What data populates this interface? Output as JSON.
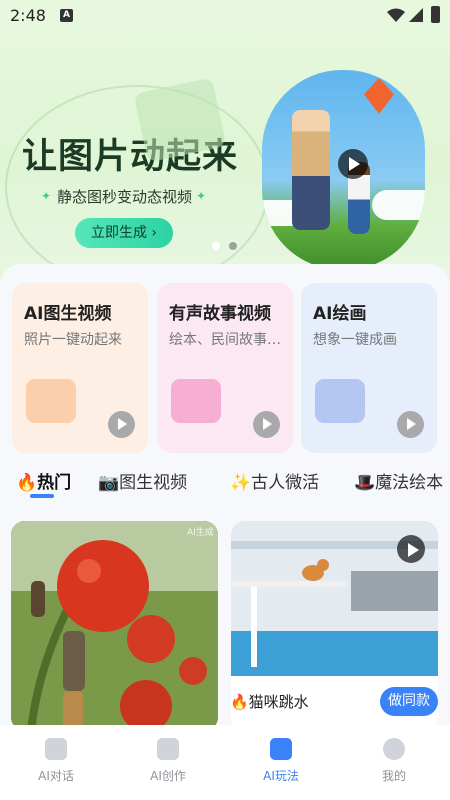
{
  "status_bar": {
    "time": "2:48",
    "notification_badge": "A"
  },
  "hero": {
    "title": "让图片动起来",
    "subtitle": "静态图秒变动态视频",
    "cta_label": "立即生成 ›",
    "carousel_pages": 2,
    "carousel_active_index": 0
  },
  "feature_cards": [
    {
      "title": "AI图生视频",
      "desc": "照片一键动起来",
      "color": "#fdefe4",
      "art_color": "#f9b27e"
    },
    {
      "title": "有声故事视频",
      "desc": "绘本、民间故事…",
      "color": "#fbe8f3",
      "art_color": "#f37db6"
    },
    {
      "title": "AI绘画",
      "desc": "想象一键成画",
      "color": "#e6eefc",
      "art_color": "#8ba8ea"
    }
  ],
  "category_tabs": [
    {
      "icon": "🔥",
      "label": "热门",
      "active": true
    },
    {
      "icon": "📷",
      "label": "图生视频",
      "active": false
    },
    {
      "icon": "✨",
      "label": "古人微活",
      "active": false
    },
    {
      "icon": "🎩",
      "label": "魔法绘本",
      "active": false
    }
  ],
  "feed": {
    "left_watermark": "AI生成",
    "right_title": "🔥猫咪跳水",
    "right_button": "做同款"
  },
  "bottom_nav": [
    {
      "label": "AI对话",
      "icon": "chat-icon",
      "active": false
    },
    {
      "label": "AI创作",
      "icon": "briefcase-icon",
      "active": false
    },
    {
      "label": "AI玩法",
      "icon": "brush-icon",
      "active": true
    },
    {
      "label": "我的",
      "icon": "profile-icon",
      "active": false
    }
  ],
  "colors": {
    "accent": "#3a82f7",
    "cta": "#2bd3a3"
  }
}
